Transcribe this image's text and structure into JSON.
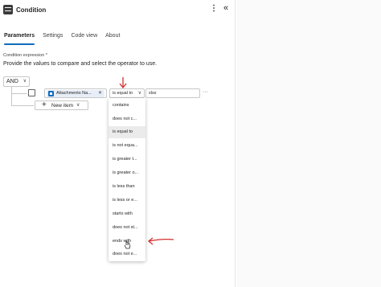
{
  "header": {
    "title": "Condition",
    "more_icon": "more-vertical-icon",
    "collapse_icon": "double-chevron-left-icon"
  },
  "tabs": [
    {
      "label": "Parameters",
      "active": true
    },
    {
      "label": "Settings",
      "active": false
    },
    {
      "label": "Code view",
      "active": false
    },
    {
      "label": "About",
      "active": false
    }
  ],
  "condition": {
    "expression_label": "Condition expression *",
    "description": "Provide the values to compare and select the operator to use.",
    "group_operator": "AND",
    "row": {
      "left_token": "Attachments Na...",
      "operator": "is equal to",
      "value": "xlsx"
    },
    "new_item_label": "New item"
  },
  "operator_options": [
    "contains",
    "does not c...",
    "is equal to",
    "is not equa...",
    "is greater t...",
    "is greater o...",
    "is less than",
    "is less or e...",
    "starts with",
    "does not st...",
    "ends with",
    "does not e..."
  ],
  "selected_option_index": 2,
  "colors": {
    "accent": "#0f6cbd",
    "annotation_arrow": "#d32f2f"
  }
}
